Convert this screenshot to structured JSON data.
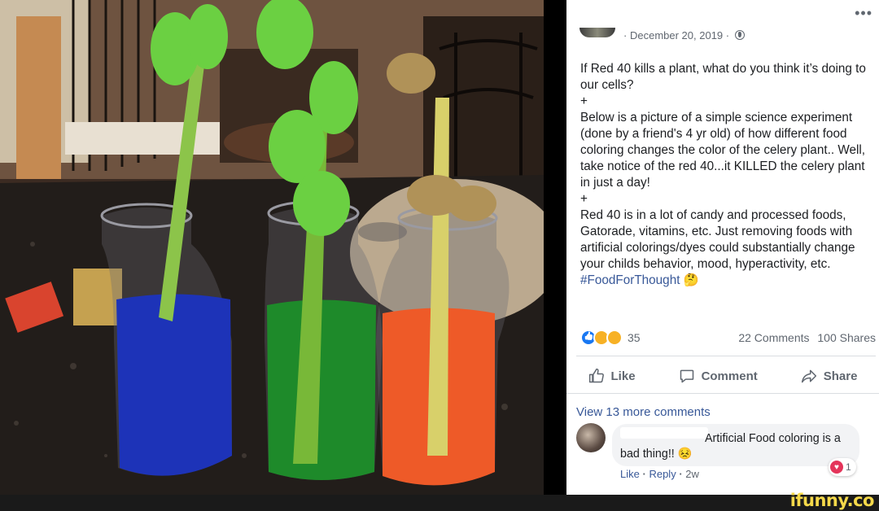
{
  "post": {
    "more_icon": "more-horizontal-icon",
    "date": "December 20, 2019",
    "date_prefix": "·",
    "date_suffix": "·",
    "privacy_icon": "globe-icon",
    "paragraphs": [
      "If Red 40 kills a plant, what do you think it’s doing to our cells?",
      "+",
      "Below is a picture of a simple science experiment (done by a friend's 4 yr old) of how different food coloring changes the color of the celery plant.. Well, take notice of the red 40...it KILLED the celery plant in just a day!",
      "+",
      "Red 40 is in a lot of candy and processed foods, Gatorade, vitamins, etc. Just removing foods with artificial colorings/dyes could substantially change your childs behavior, mood, hyperactivity, etc."
    ],
    "hashtag": "#FoodForThought",
    "hashtag_emoji": "🤔",
    "reaction_icons": [
      "like-reaction-icon",
      "wow-reaction-icon",
      "sad-reaction-icon"
    ],
    "reaction_count": "35",
    "comments_count": "22 Comments",
    "shares_count": "100 Shares"
  },
  "actions": {
    "like": "Like",
    "comment": "Comment",
    "share": "Share"
  },
  "comments": {
    "view_more": "View 13 more comments",
    "first": {
      "text": "Artificial Food coloring is a bad thing!!",
      "emoji": "😣",
      "like": "Like",
      "reply": "Reply",
      "time": "2w",
      "reaction_icon": "love-reaction-icon",
      "reaction_count": "1"
    }
  },
  "watermark": "ifunny.co",
  "colors": {
    "link_blue": "#385898",
    "text": "#1c1e21",
    "muted": "#606770",
    "watermark_yellow": "#f5d94a"
  }
}
